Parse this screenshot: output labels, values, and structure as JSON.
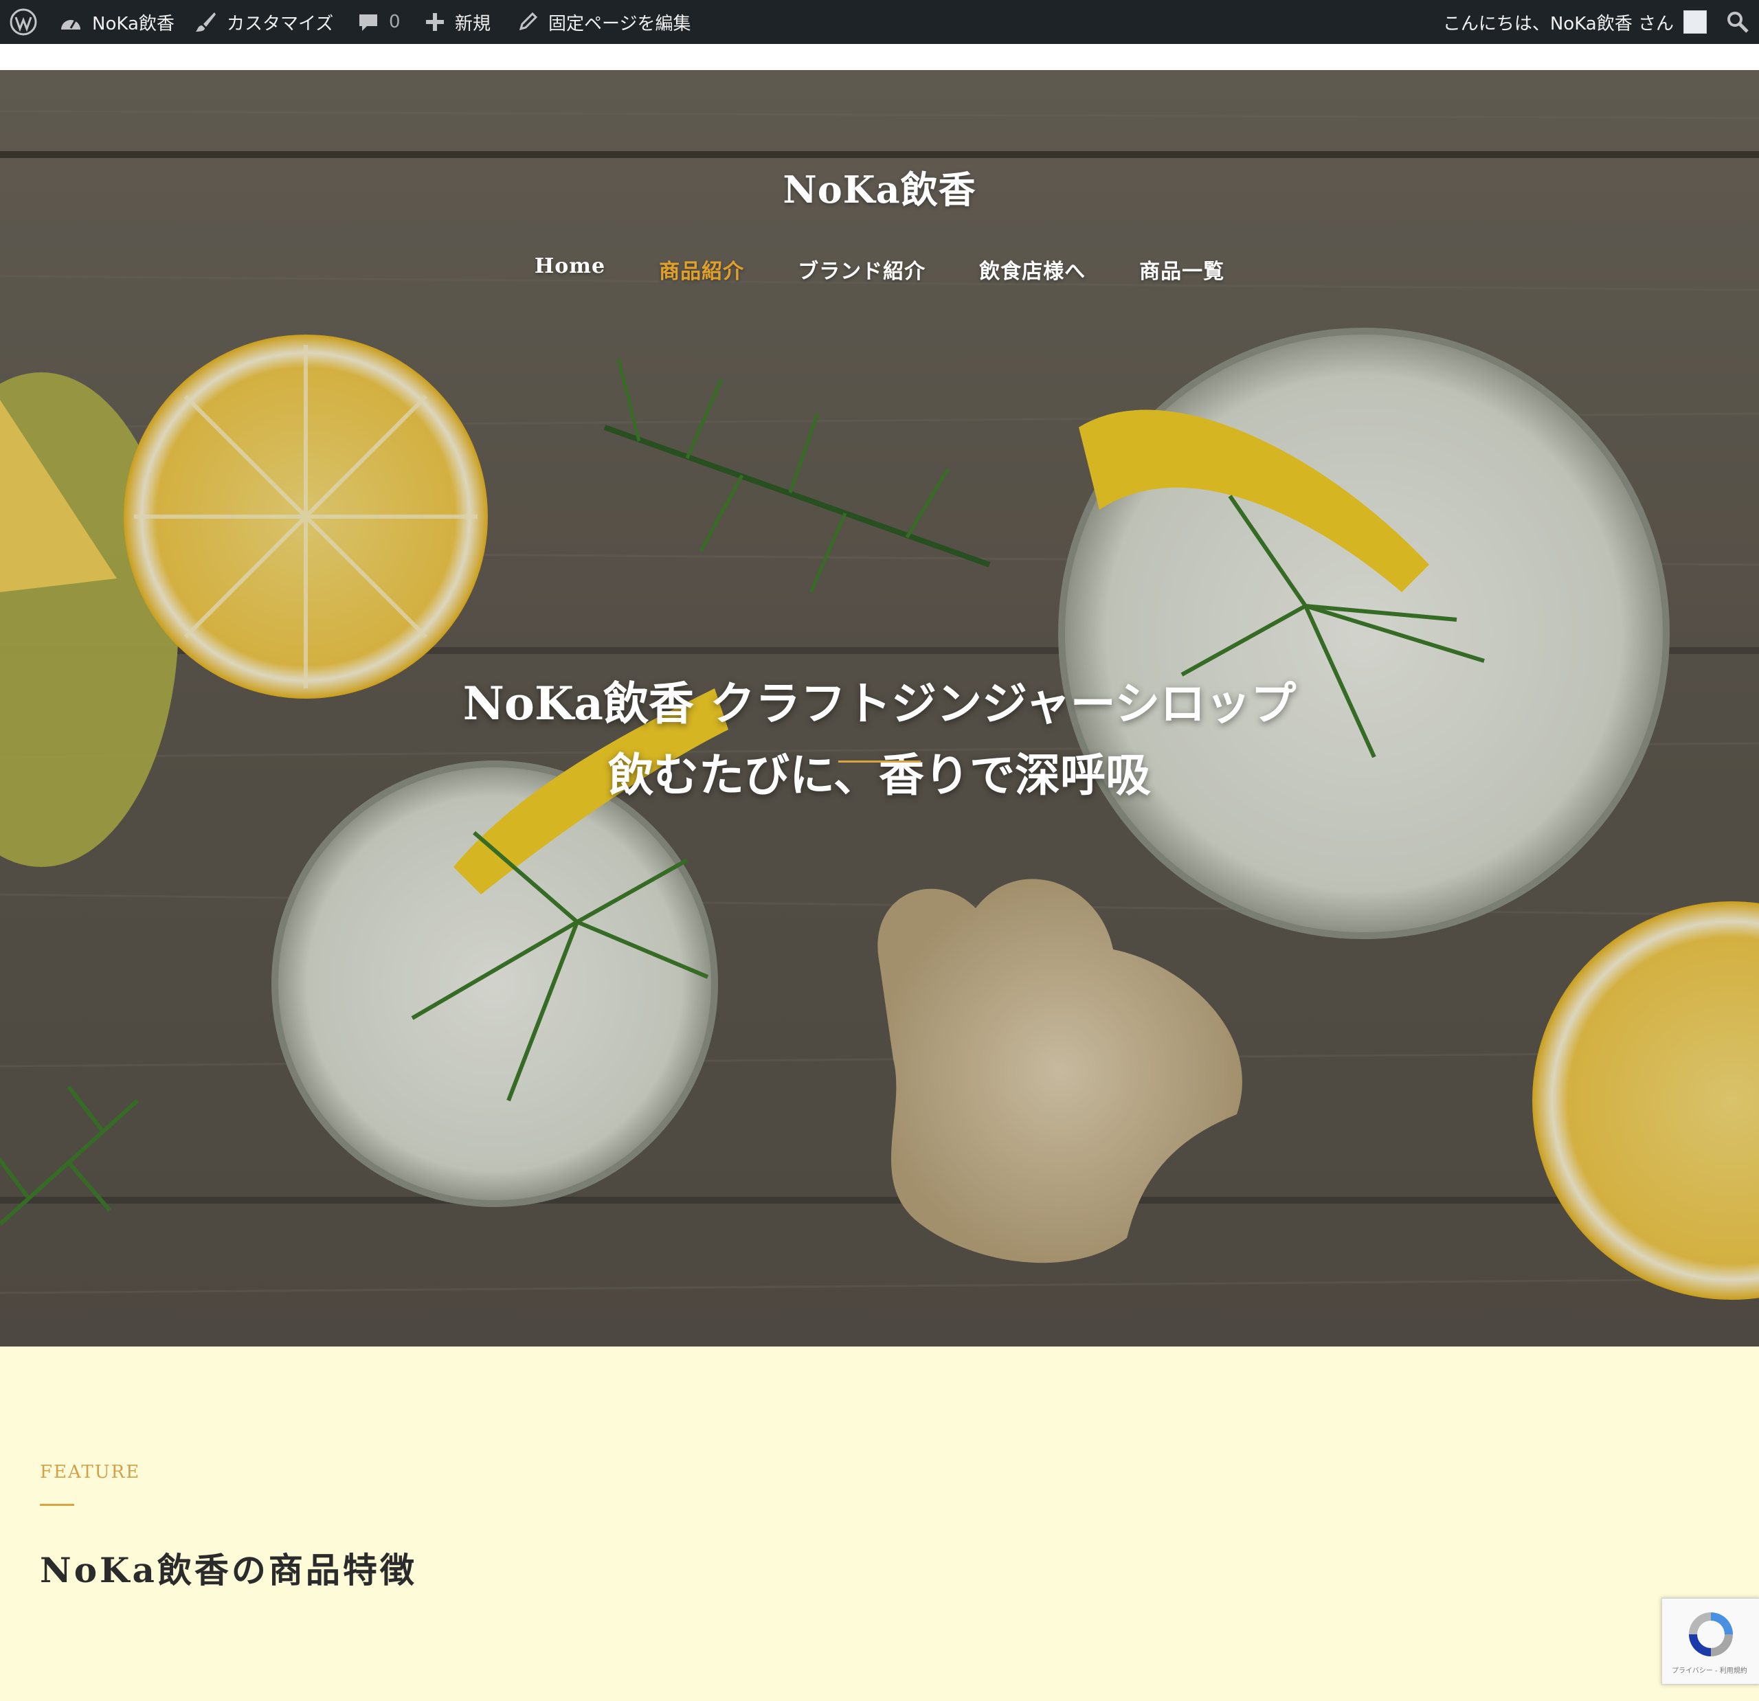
{
  "adminbar": {
    "site_name": "NoKa飲香",
    "customize": "カスタマイズ",
    "comments_count": "0",
    "new": "新規",
    "edit_page": "固定ページを編集",
    "greeting": "こんにちは、NoKa飲香 さん",
    "icons": [
      "wordpress-icon",
      "dashboard-icon",
      "brush-icon",
      "comment-icon",
      "plus-icon",
      "pencil-icon",
      "search-icon"
    ]
  },
  "header": {
    "site_title": "NoKa飲香",
    "nav": [
      {
        "label": "Home"
      },
      {
        "label": "商品紹介"
      },
      {
        "label": "ブランド紹介"
      },
      {
        "label": "飲食店様へ"
      },
      {
        "label": "商品一覧"
      }
    ],
    "current_index": 1
  },
  "hero": {
    "line1": "NoKa飲香 クラフトジンジャーシロップ",
    "line2": "飲むたびに、香りで深呼吸"
  },
  "feature": {
    "kicker": "FEATURE",
    "title": "NoKa飲香の商品特徴"
  },
  "recaptcha": {
    "small_text": "プライバシー - 利用規約"
  },
  "colors": {
    "adminbar_bg": "#1d2327",
    "accent": "#e0a12c",
    "section_bg": "#fdfbd8"
  }
}
